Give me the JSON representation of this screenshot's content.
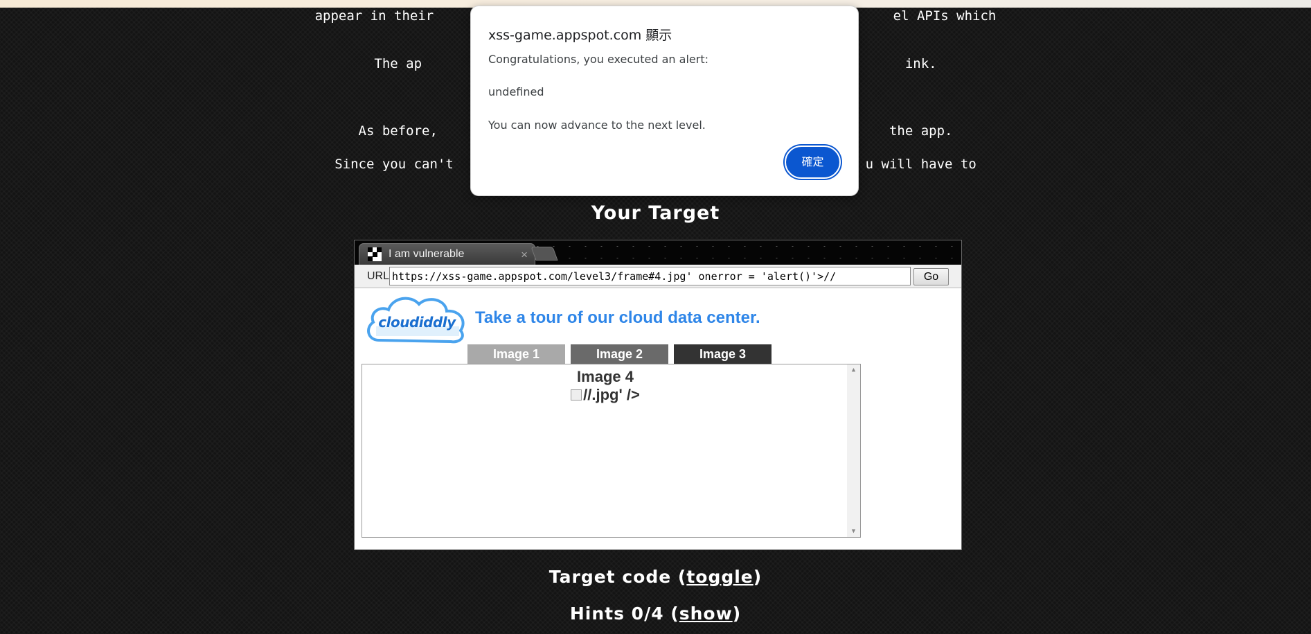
{
  "intro": {
    "line1": "appear in their                                                          el APIs which",
    "line2": "The ap                                                             ink.",
    "line3": "As before,                                                         the app.",
    "line4": "Since you can't                                                    u will have to"
  },
  "target": {
    "title": "Your Target"
  },
  "browser": {
    "tab_title": "I am vulnerable",
    "tab_close": "×",
    "url_label": "URL",
    "url_value": "https://xss-game.appspot.com/level3/frame#4.jpg' onerror = 'alert()'>//",
    "go_label": "Go"
  },
  "app": {
    "logo_text": "cloudiddly",
    "headline": "Take a tour of our cloud data center.",
    "tabs": [
      "Image 1",
      "Image 2",
      "Image 3"
    ],
    "frame_title": "Image 4",
    "broken_image_text": "//.jpg' />"
  },
  "footer": {
    "code_prefix": "Target code (",
    "code_link": "toggle",
    "code_suffix": ")",
    "hints_prefix": "Hints 0/4 (",
    "hints_link": "show",
    "hints_suffix": ")"
  },
  "dialog": {
    "title": "xss-game.appspot.com 顯示",
    "line1": "Congratulations, you executed an alert:",
    "line2": "undefined",
    "line3": "You can now advance to the next level.",
    "ok_label": "確定"
  },
  "colors": {
    "accent": "#0b57d0",
    "headline": "#2f86e8",
    "page_bg": "#141414"
  }
}
